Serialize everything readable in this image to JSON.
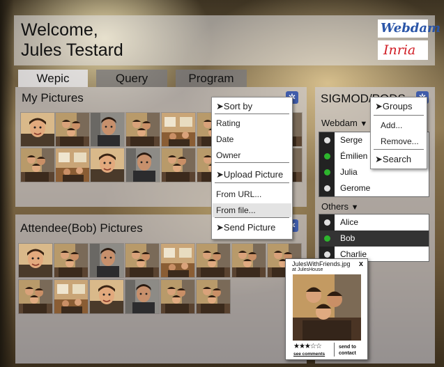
{
  "header": {
    "welcome": "Welcome,\nJules Testard",
    "logo_webdam": "Webdam",
    "logo_inria": "Inria"
  },
  "tabs": [
    {
      "label": "Wepic",
      "active": true
    },
    {
      "label": "Query",
      "active": false
    },
    {
      "label": "Program",
      "active": false
    }
  ],
  "my_pictures": {
    "title": "My Pictures"
  },
  "attendee_pictures": {
    "title": "Attendee(Bob) Pictures"
  },
  "picture_menu": {
    "sort_by": "Sort by",
    "rating": "Rating",
    "date": "Date",
    "owner": "Owner",
    "upload": "Upload Picture",
    "from_url": "From URL...",
    "from_file": "From file...",
    "send": "Send Picture"
  },
  "sigmod": {
    "title": "SIGMOD/PODS",
    "webdam_group": "Webdam",
    "webdam_members": [
      {
        "name": "Serge",
        "status": "white"
      },
      {
        "name": "Émilien",
        "status": "green"
      },
      {
        "name": "Julia",
        "status": "green"
      },
      {
        "name": "Gerome",
        "status": "white"
      }
    ],
    "others_group": "Others",
    "others_members": [
      {
        "name": "Alice",
        "status": "white"
      },
      {
        "name": "Bob",
        "status": "green"
      },
      {
        "name": "Charlie",
        "status": "white"
      }
    ]
  },
  "groups_menu": {
    "groups": "Groups",
    "add": "Add...",
    "remove": "Remove...",
    "search": "Search"
  },
  "photo_popup": {
    "filename": "JulesWithFriends.jpg",
    "location": "at JulesHouse",
    "rating": 3,
    "rating_max": 5,
    "stars": "★★★☆☆",
    "see_comments": "see comments",
    "send_to_contact": "send to contact",
    "close": "x"
  },
  "icons": {
    "arrow": "➤",
    "dropdown": "▼",
    "gear": "✲"
  },
  "colors": {
    "online": "#2db52d",
    "offline": "#e0e0e0",
    "selected_row": "#333333",
    "gear_blue": "#3f5caa"
  }
}
